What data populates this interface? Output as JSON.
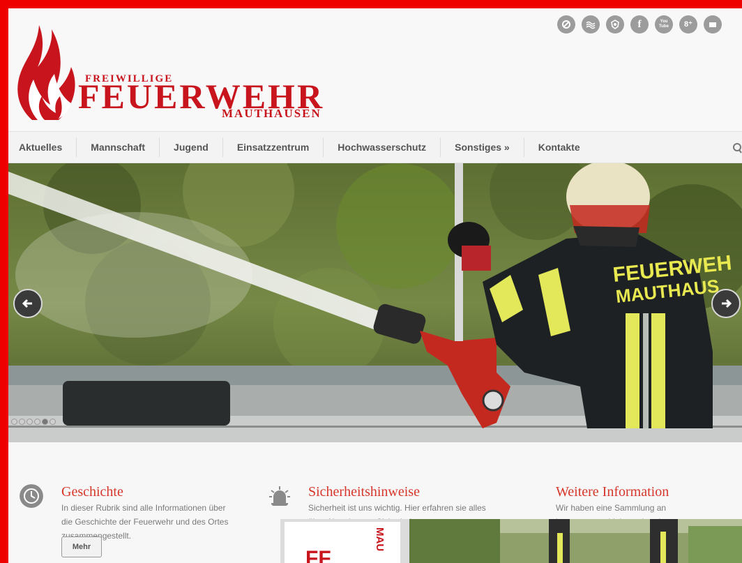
{
  "logo": {
    "line1": "FREIWILLIGE",
    "line2": "FEUERWEHR",
    "line3": "MAUTHAUSEN",
    "color": "#c8141c"
  },
  "social_icons": [
    {
      "name": "gear-cog-icon",
      "glyph": ""
    },
    {
      "name": "waves-icon",
      "glyph": ""
    },
    {
      "name": "emblem-icon",
      "glyph": ""
    },
    {
      "name": "facebook-icon",
      "glyph": "f"
    },
    {
      "name": "youtube-icon",
      "glyph": "You Tube"
    },
    {
      "name": "google-plus-icon",
      "glyph": "8⁺"
    },
    {
      "name": "email-icon",
      "glyph": ""
    }
  ],
  "nav": {
    "items": [
      "Aktuelles",
      "Mannschaft",
      "Jugend",
      "Einsatzzentrum",
      "Hochwasserschutz",
      "Sonstiges »",
      "Kontakte"
    ]
  },
  "slider": {
    "jacket_text_line1": "FEUERWEH",
    "jacket_text_line2": "MAUTHAUS",
    "dots_total": 6,
    "active_dot": 5
  },
  "blocks": {
    "geschichte": {
      "title": "Geschichte",
      "text": "In dieser Rubrik sind alle Informationen über die Geschichte der Feuerwehr und des Ortes zusammengestellt.",
      "button": "Mehr"
    },
    "sicherheit": {
      "title": "Sicherheitshinweise",
      "text": "Sicherheit ist uns wichtig. Hier erfahren sie alles über Alarmierung, Sicherheit,..."
    },
    "weitere": {
      "title": "Weitere Information",
      "text": "Wir haben eine Sammlung an interessanten Links vorbereitet."
    }
  },
  "thumb1": {
    "vertical_text": "MAU",
    "big_text": "FF"
  },
  "colors": {
    "accent_red": "#d6372a",
    "frame_red": "#ee0000"
  }
}
